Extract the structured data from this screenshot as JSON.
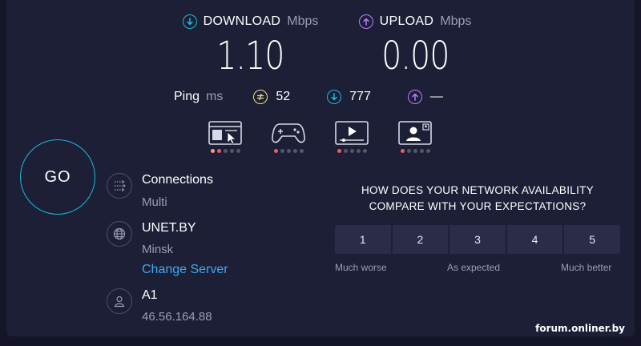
{
  "download": {
    "label": "DOWNLOAD",
    "unit": "Mbps",
    "value": "1.10"
  },
  "upload": {
    "label": "UPLOAD",
    "unit": "Mbps",
    "value": "0.00"
  },
  "ping": {
    "label": "Ping",
    "unit": "ms",
    "idle": "52",
    "download": "777",
    "upload": "—"
  },
  "apps": [
    {
      "icon": "web-browsing-icon",
      "rating": 2
    },
    {
      "icon": "gaming-icon",
      "rating": 1
    },
    {
      "icon": "video-streaming-icon",
      "rating": 1
    },
    {
      "icon": "video-chat-icon",
      "rating": 1
    }
  ],
  "go_label": "GO",
  "connections": {
    "title": "Connections",
    "value": "Multi"
  },
  "server": {
    "name": "UNET.BY",
    "location": "Minsk",
    "change_label": "Change Server"
  },
  "provider": {
    "name": "A1",
    "ip": "46.56.164.88"
  },
  "survey": {
    "question_line1": "HOW DOES YOUR NETWORK AVAILABILITY",
    "question_line2": "COMPARE WITH YOUR EXPECTATIONS?",
    "options": [
      "1",
      "2",
      "3",
      "4",
      "5"
    ],
    "low_label": "Much worse",
    "mid_label": "As expected",
    "high_label": "Much better"
  },
  "watermark": "forum.onliner.by",
  "colors": {
    "background": "#141526",
    "panel": "#1d1f36",
    "download_accent": "#1bbbd6",
    "upload_accent": "#b681ff",
    "ping_accent": "#f4e07a",
    "link": "#3fa9f0",
    "dot_active": "#ef5b64",
    "dot_partial": "#f4a07a"
  }
}
